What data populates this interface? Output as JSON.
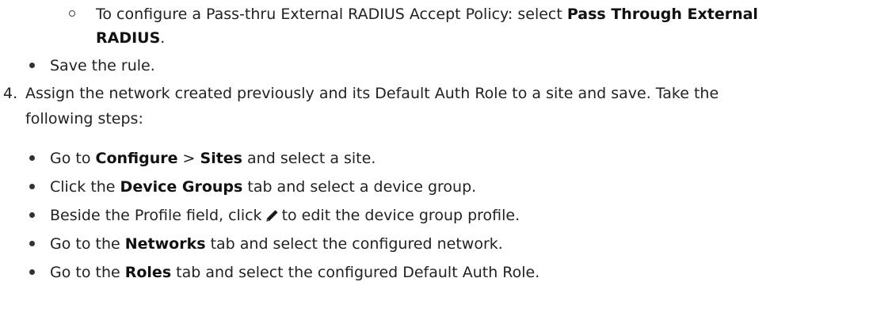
{
  "item_pass_thru": {
    "prefix": "To configure a Pass-thru External RADIUS Accept Policy: select ",
    "bold": "Pass Through External",
    "bold_cont": "RADIUS",
    "suffix": "."
  },
  "item_save_rule": {
    "text": "Save the rule."
  },
  "step4": {
    "number": "4.",
    "line1": "Assign the network created previously and its Default Auth Role to a site and save. Take the",
    "line2": "following steps:"
  },
  "substeps": [
    {
      "t1": "Go to ",
      "b1": "Configure",
      "t2": " > ",
      "b2": "Sites",
      "t3": " and select a site."
    },
    {
      "t1": "Click the ",
      "b1": "Device Groups",
      "t2": " tab and select a device group."
    },
    {
      "t1": "Beside the Profile field, click",
      "t2": "to edit the device group profile."
    },
    {
      "t1": "Go to the ",
      "b1": "Networks",
      "t2": " tab and select the configured network."
    },
    {
      "t1": "Go to the ",
      "b1": "Roles",
      "t2": " tab and select the configured Default Auth Role."
    }
  ],
  "icons": {
    "edit": "pencil-icon"
  }
}
